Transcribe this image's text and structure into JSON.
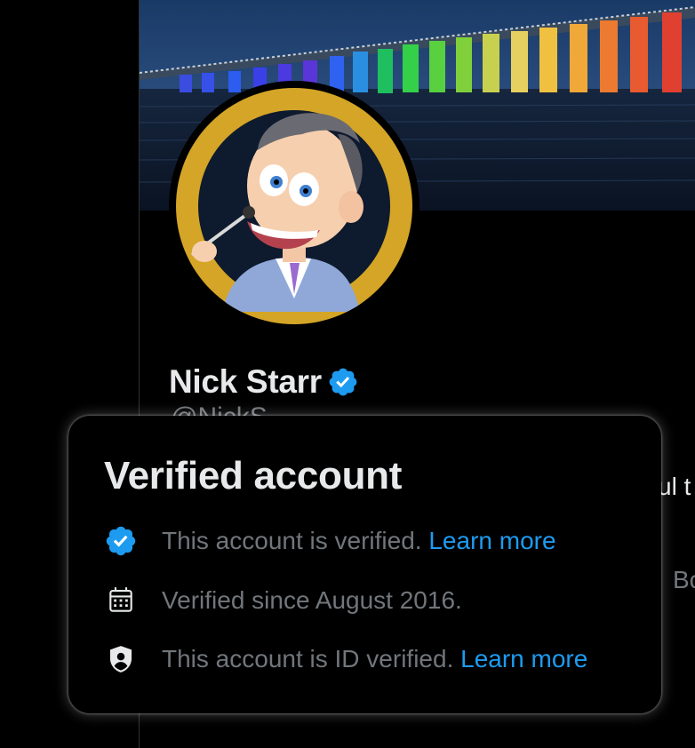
{
  "profile": {
    "name": "Nick Starr",
    "handle": "@NickS..."
  },
  "peek_text": {
    "bio": "ul t",
    "meta": "Bo"
  },
  "popover": {
    "title": "Verified account",
    "rows": [
      {
        "icon": "verified-badge-icon",
        "text": "This account is verified.",
        "link": "Learn more"
      },
      {
        "icon": "calendar-icon",
        "text": "Verified since August 2016."
      },
      {
        "icon": "id-shield-icon",
        "text": "This account is ID verified.",
        "link": "Learn more"
      }
    ]
  },
  "colors": {
    "background": "#000000",
    "text_primary": "#e7e9ea",
    "text_secondary": "#71767b",
    "link": "#1d9bf0",
    "verified_badge": "#1d9bf0",
    "avatar_ring": "#d4a526"
  }
}
